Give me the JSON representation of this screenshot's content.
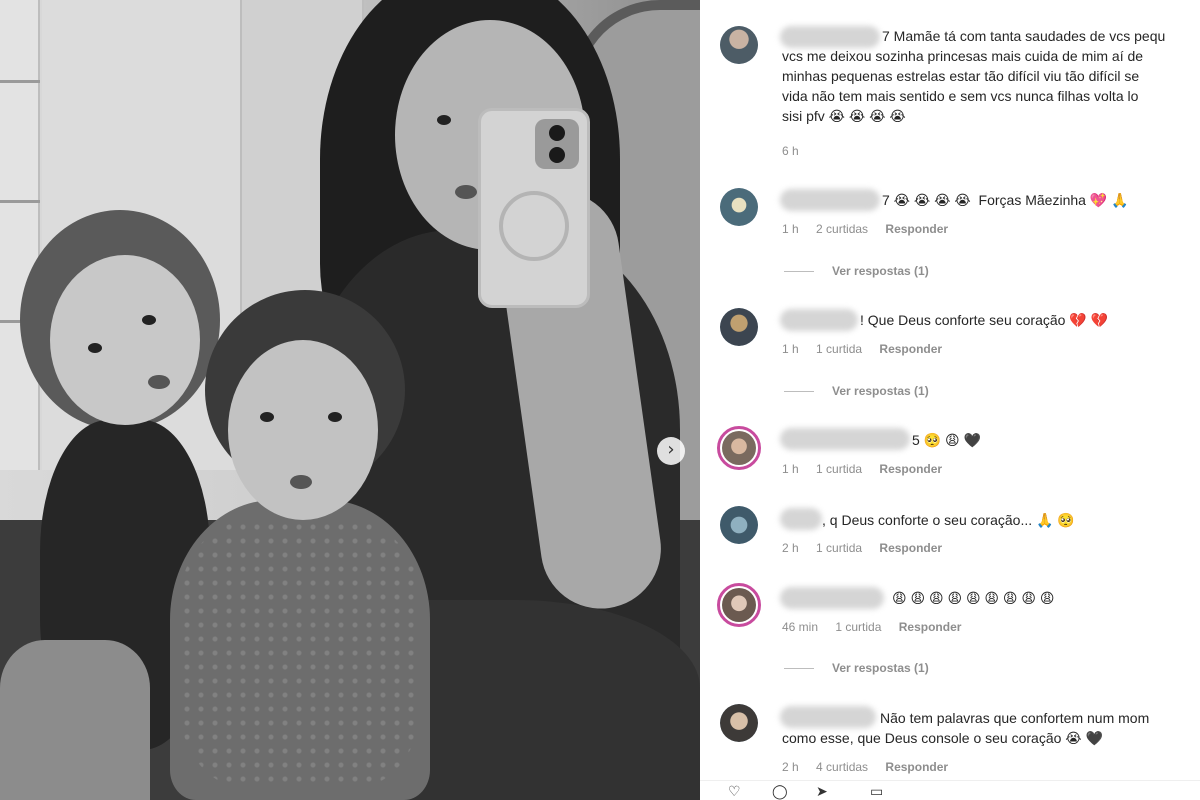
{
  "post": {
    "carousel_next_glyph": "›"
  },
  "comments": [
    {
      "text": "7 Mamãe tá com tanta saudades de vcs pequ\nvcs me deixou sozinha princesas mais cuida de mim aí de\nminhas pequenas estrelas estar tão difícil viu tão difícil se\nvida não tem mais sentido e sem vcs nunca filhas volta lo\nsisi pfv 😭 😭 😭 😭",
      "time": "6 h"
    },
    {
      "text": "7 😭 😭 😭 😭  Forças Mãezinha 💖 🙏",
      "time": "1 h",
      "likes": "2 curtidas",
      "reply": "Responder",
      "view_replies": "Ver respostas (1)"
    },
    {
      "text": "! Que Deus conforte seu coração 💔 💔",
      "time": "1 h",
      "likes": "1 curtida",
      "reply": "Responder",
      "view_replies": "Ver respostas (1)"
    },
    {
      "text": "5 🥺 😩 🖤",
      "time": "1 h",
      "likes": "1 curtida",
      "reply": "Responder"
    },
    {
      "text": ", q Deus conforte o seu coração... 🙏 🥺",
      "time": "2 h",
      "likes": "1 curtida",
      "reply": "Responder"
    },
    {
      "text": "😩 😩 😩 😩 😩 😩 😩 😩 😩",
      "time": "46 min",
      "likes": "1 curtida",
      "reply": "Responder",
      "view_replies": "Ver respostas (1)"
    },
    {
      "text": "Não tem palavras que confortem num mom\ncomo esse, que Deus console o seu coração 😭 🖤",
      "time": "2 h",
      "likes": "4 curtidas",
      "reply": "Responder"
    }
  ],
  "colors": {
    "story_ring": "#c84b9e",
    "meta_text": "#8e8e8e",
    "comment_text": "#262626"
  }
}
